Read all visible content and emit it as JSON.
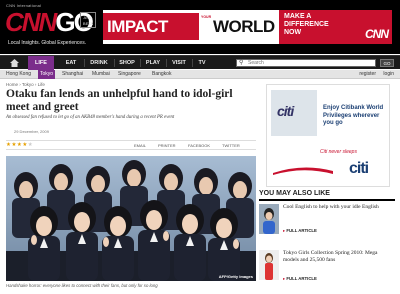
{
  "header": {
    "brand_top": "CNN International",
    "logo_text": "CNN",
    "logo_go": "GO",
    "edition": "ASIA BETA",
    "tagline": "Local Insights. Global Experiences."
  },
  "banner_ad": {
    "impact": "IMPACT",
    "your": "YOUR",
    "world": "WORLD",
    "headline": "MAKE A DIFFERENCE NOW",
    "brand": "CNN"
  },
  "nav": {
    "items": [
      "LIFE",
      "EAT",
      "DRINK",
      "SHOP",
      "PLAY",
      "VISIT",
      "TV"
    ],
    "search_placeholder": "Search",
    "go_label": "GO"
  },
  "city_bar": {
    "cities": [
      "Hong Kong",
      "Tokyo",
      "Shanghai",
      "Mumbai",
      "Singapore",
      "Bangkok"
    ],
    "active_city": "Tokyo",
    "register": "register",
    "login": "login"
  },
  "article": {
    "breadcrumb": "Home › Tokyo › Life",
    "title": "Otaku fan lends an unhelpful hand to idol-girl meet and greet",
    "subtitle": "An obsessed fan refused to let go of an AKB48 member's hand during a recent PR event",
    "date": "29 December, 2009",
    "rating": 4,
    "tools": [
      "EMAIL",
      "PRINTER",
      "FACEBOOK",
      "TWITTER"
    ],
    "photo_credit": "AFP/Getty Images",
    "caption": "Handshake horror: everyone likes to connect with their fans, but only for so long"
  },
  "side_ad": {
    "brand_small": "citi",
    "text": "Enjoy Citibank World Privileges wherever you go",
    "never_sleeps": "Citi never sleeps",
    "brand": "citi"
  },
  "also_like": {
    "heading": "YOU MAY ALSO LIKE",
    "items": [
      {
        "title": "Cool English to help with your idle English",
        "link": "FULL ARTICLE"
      },
      {
        "title": "Tokyo Girls Collection Spring 2010: Mega models and 25,500 fans",
        "link": "FULL ARTICLE"
      }
    ]
  },
  "colors": {
    "cnn_red": "#c8102e",
    "life_purple": "#7b2d8b",
    "citi_blue": "#1b3f73",
    "star_gold": "#e6a000"
  }
}
